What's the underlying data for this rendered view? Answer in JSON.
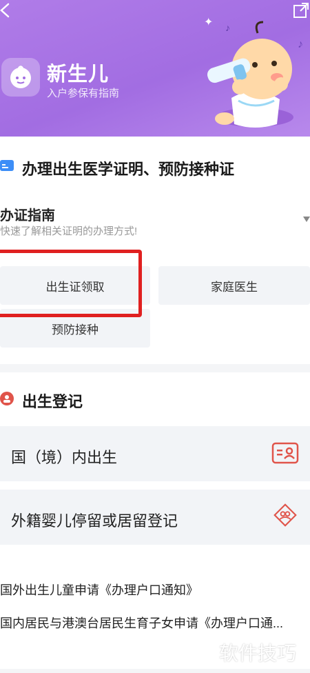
{
  "header": {
    "title": "新生儿",
    "subtitle": "入户参保有指南"
  },
  "section_certificates": {
    "title": "办理出生医学证明、预防接种证",
    "guide_title": "办证指南",
    "guide_sub": "快速了解相关证明的办理方式!",
    "buttons": [
      "出生证领取",
      "家庭医生",
      "预防接种"
    ]
  },
  "section_birth": {
    "title": "出生登记",
    "items": [
      "国（境）内出生",
      "外籍婴儿停留或居留登记"
    ],
    "links": [
      "国外出生儿童申请《办理户口通知》",
      "国内居民与港澳台居民生育子女申请《办理户口通..."
    ]
  },
  "watermark": "软件技巧",
  "colors": {
    "banner": "#a26de2",
    "accent_blue": "#3d8ef7",
    "accent_red": "#e0544a",
    "highlight": "#e02020"
  }
}
